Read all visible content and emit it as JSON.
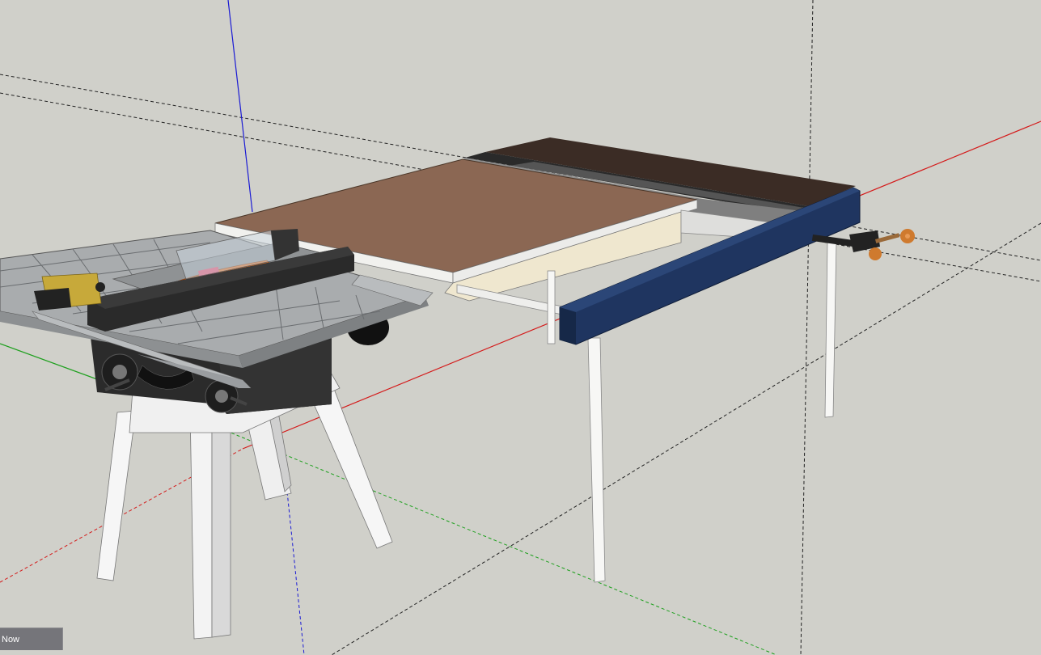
{
  "scene_tab": {
    "label": "Now"
  },
  "colors": {
    "background": "#d0d0ca",
    "axis_red": "#d41a1a",
    "axis_green": "#1ea01e",
    "axis_blue": "#1a1ad4",
    "table_top": "#8b6753",
    "fence_rail": "#1f3560",
    "saw_table": "#a9acae",
    "saw_body": "#2b2b2b",
    "stand_legs": "#f6f6f6",
    "clamp_handle": "#cf7a2e",
    "blade": "#e06a1c",
    "fence_lock": "#c7a93a"
  }
}
